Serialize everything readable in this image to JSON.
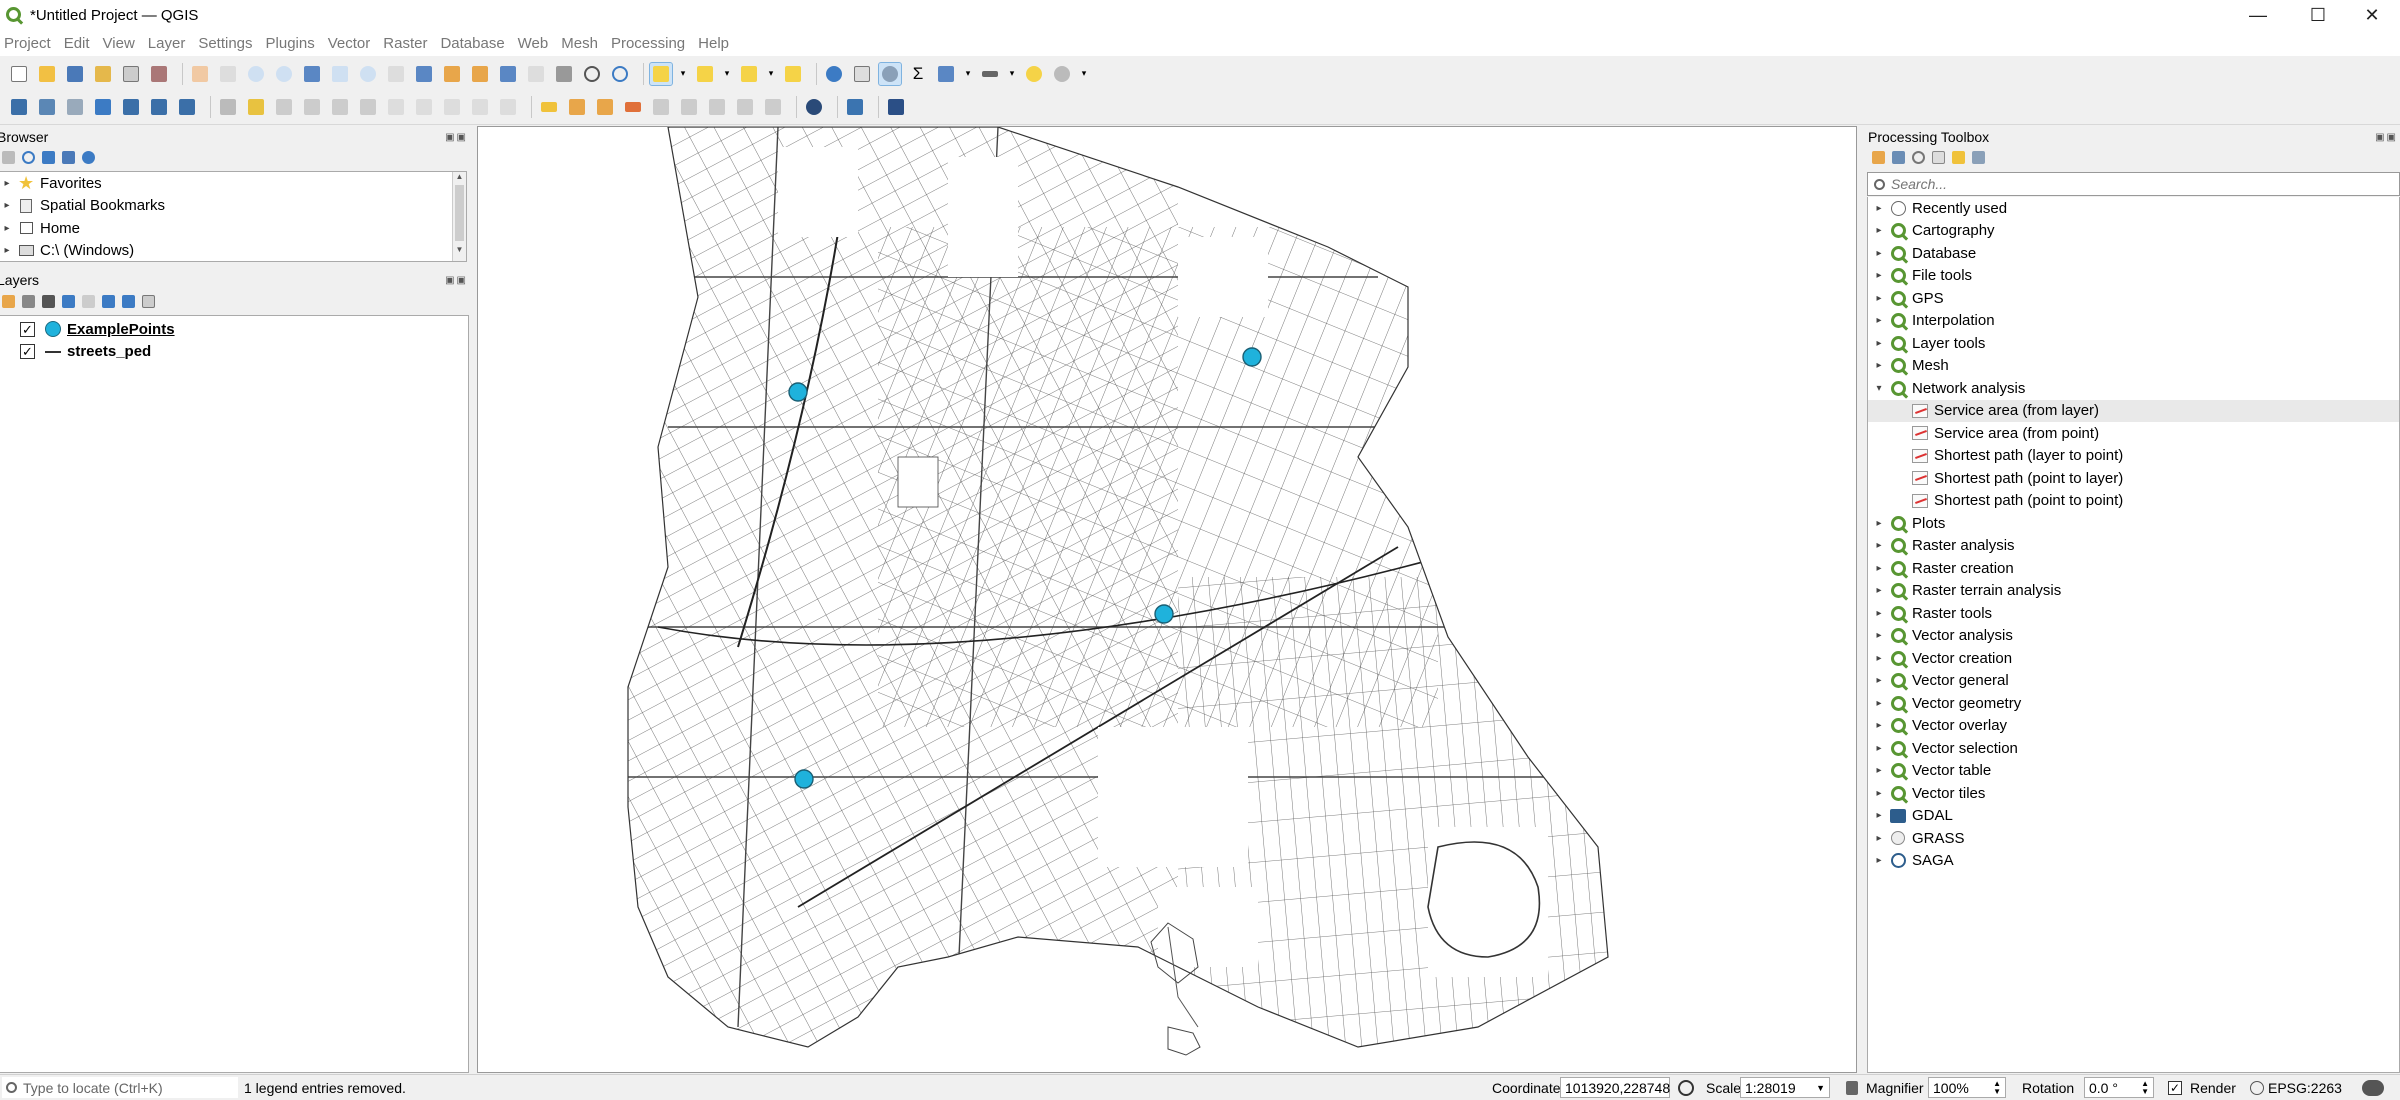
{
  "window": {
    "title": "*Untitled Project — QGIS"
  },
  "menu": [
    "Project",
    "Edit",
    "View",
    "Layer",
    "Settings",
    "Plugins",
    "Vector",
    "Raster",
    "Database",
    "Web",
    "Mesh",
    "Processing",
    "Help"
  ],
  "browser": {
    "title": "Browser",
    "items": [
      {
        "label": "Favorites",
        "icon": "star-icon"
      },
      {
        "label": "Spatial Bookmarks",
        "icon": "bookmark-icon"
      },
      {
        "label": "Home",
        "icon": "home-icon"
      },
      {
        "label": "C:\\ (Windows)",
        "icon": "drive-icon"
      }
    ]
  },
  "layers": {
    "title": "Layers",
    "items": [
      {
        "label": "ExamplePoints",
        "checked": true,
        "symbol": "point",
        "color": "#1fb2dc"
      },
      {
        "label": "streets_ped",
        "checked": true,
        "symbol": "line",
        "color": "#333333"
      }
    ]
  },
  "toolbox": {
    "title": "Processing Toolbox",
    "search_placeholder": "Search...",
    "groups_before": [
      "Recently used",
      "Cartography",
      "Database",
      "File tools",
      "GPS",
      "Interpolation",
      "Layer tools",
      "Mesh"
    ],
    "expanded_group": "Network analysis",
    "algorithms": [
      "Service area (from layer)",
      "Service area (from point)",
      "Shortest path (layer to point)",
      "Shortest path (point to layer)",
      "Shortest path (point to point)"
    ],
    "groups_after": [
      "Plots",
      "Raster analysis",
      "Raster creation",
      "Raster terrain analysis",
      "Raster tools",
      "Vector analysis",
      "Vector creation",
      "Vector general",
      "Vector geometry",
      "Vector overlay",
      "Vector selection",
      "Vector table",
      "Vector tiles"
    ],
    "providers": [
      "GDAL",
      "GRASS",
      "SAGA"
    ]
  },
  "status": {
    "locate_placeholder": "Type to locate (Ctrl+K)",
    "message": "1 legend entries removed.",
    "coordinate_label": "Coordinate",
    "coordinate": "1013920,228748",
    "scale_label": "Scale",
    "scale": "1:28019",
    "magnifier_label": "Magnifier",
    "magnifier": "100%",
    "rotation_label": "Rotation",
    "rotation": "0.0 °",
    "render_label": "Render",
    "crs": "EPSG:2263"
  },
  "map": {
    "point_color": "#1fb2dc",
    "points": [
      "point-1",
      "point-2",
      "point-3",
      "point-4"
    ]
  }
}
